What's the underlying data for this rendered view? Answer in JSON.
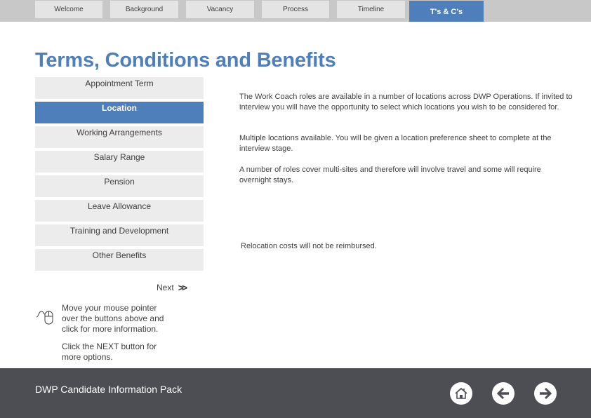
{
  "nav": {
    "tabs": [
      {
        "label": "Welcome",
        "active": false
      },
      {
        "label": "Background",
        "active": false
      },
      {
        "label": "Vacancy",
        "active": false
      },
      {
        "label": "Process",
        "active": false
      },
      {
        "label": "Timeline",
        "active": false
      },
      {
        "label": "T's & C's",
        "active": true
      }
    ]
  },
  "page": {
    "title": "Terms, Conditions and Benefits"
  },
  "menu": {
    "items": [
      {
        "label": "Appointment Term",
        "active": false
      },
      {
        "label": "Location",
        "active": true
      },
      {
        "label": "Working Arrangements",
        "active": false
      },
      {
        "label": "Salary Range",
        "active": false
      },
      {
        "label": "Pension",
        "active": false
      },
      {
        "label": "Leave Allowance",
        "active": false
      },
      {
        "label": "Training and Development",
        "active": false
      },
      {
        "label": "Other Benefits",
        "active": false
      }
    ]
  },
  "content": {
    "paragraphs": [
      "The Work Coach roles are available in a number of locations across DWP Operations.  If invited to interview you will have the opportunity to select which locations you wish to be considered for.",
      "Multiple locations available. You will be given a location preference sheet to complete at the interview stage.",
      "A number of roles cover multi-sites and therefore will involve travel and some will require overnight stays.",
      "Relocation costs will not be reimbursed."
    ]
  },
  "next": {
    "label": "Next",
    "arrows": ">>"
  },
  "help": {
    "line1": "Move your mouse pointer over the buttons above and click for more information.",
    "line2": "Click the NEXT button for more options."
  },
  "footer": {
    "title": "DWP Candidate Information Pack",
    "buttons": [
      {
        "icon": "home-icon"
      },
      {
        "icon": "arrow-left-icon"
      },
      {
        "icon": "arrow-right-icon"
      }
    ]
  },
  "colors": {
    "accent": "#4f7fba",
    "nav_bg": "#c8c8c8",
    "tab_bg": "#e4e4e4",
    "menu_bg": "#ececec",
    "footer_bg": "#4d4e54"
  }
}
